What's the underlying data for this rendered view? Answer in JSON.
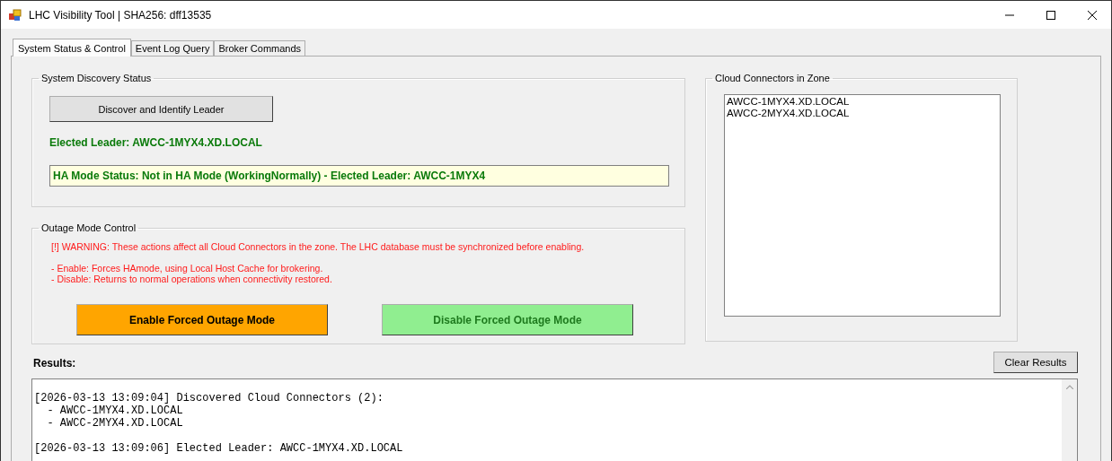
{
  "window": {
    "title": "LHC Visibility Tool | SHA256: dff13535"
  },
  "tabs": [
    {
      "label": "System Status & Control",
      "selected": true
    },
    {
      "label": "Event Log Query",
      "selected": false
    },
    {
      "label": "Broker Commands",
      "selected": false
    }
  ],
  "discovery": {
    "title": "System Discovery  Status",
    "button": "Discover and Identify Leader",
    "leader": "Elected Leader: AWCC-1MYX4.XD.LOCAL",
    "ha_status": "HA Mode Status: Not in HA Mode (WorkingNormally) - Elected Leader: AWCC-1MYX4"
  },
  "outage": {
    "title": "Outage Mode Control",
    "warning": "[!] WARNING: These actions affect all Cloud Connectors in the zone. The LHC database must be synchronized before enabling.",
    "notes": [
      "- Enable: Forces HAmode, using Local Host Cache for brokering.",
      "- Disable: Returns to normal operations when connectivity restored."
    ],
    "buttons": [
      {
        "label": "Enable Forced Outage Mode",
        "kind": "enable"
      },
      {
        "label": "Disable Forced Outage Mode",
        "kind": "disable"
      }
    ]
  },
  "connectors": {
    "title": "Cloud Connectors in Zone",
    "items": [
      "AWCC-1MYX4.XD.LOCAL",
      "AWCC-2MYX4.XD.LOCAL"
    ]
  },
  "results": {
    "label": "Results:",
    "clear_button": "Clear Results",
    "entries": [
      {
        "lines": [
          "[2026-03-13 13:09:04] Discovered Cloud Connectors (2):",
          "  - AWCC-1MYX4.XD.LOCAL",
          "  - AWCC-2MYX4.XD.LOCAL"
        ]
      },
      {
        "lines": [
          "[2026-03-13 13:09:06] Elected Leader: AWCC-1MYX4.XD.LOCAL"
        ]
      }
    ]
  }
}
